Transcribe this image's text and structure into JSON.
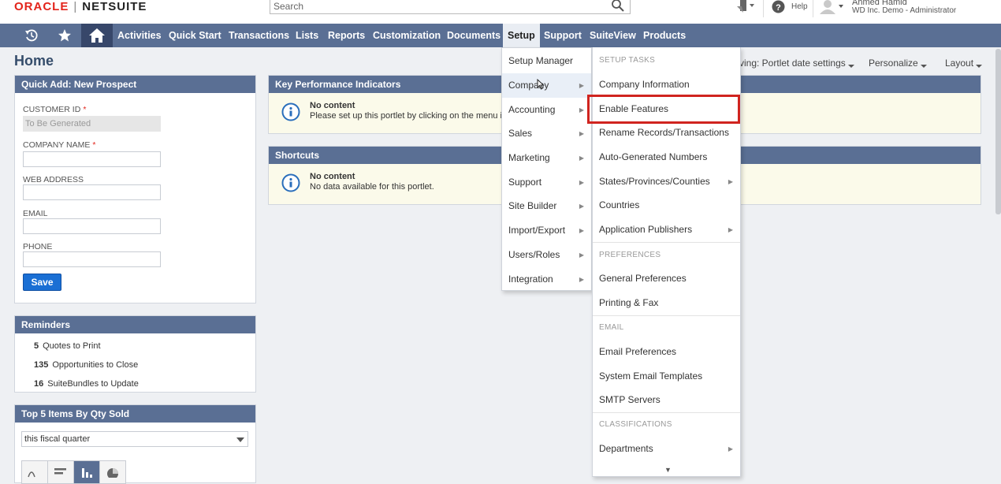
{
  "brand": {
    "oracle": "ORACLE",
    "netsuite": "NETSUITE"
  },
  "search": {
    "placeholder": "Search"
  },
  "header": {
    "help": "Help",
    "user_name": "Ahmed Hamid",
    "user_role": "WD Inc. Demo - Administrator"
  },
  "nav": {
    "items": [
      "Activities",
      "Quick Start",
      "Transactions",
      "Lists",
      "Reports",
      "Customization",
      "Documents",
      "Setup",
      "Support",
      "SuiteView",
      "Products"
    ],
    "active": "Setup"
  },
  "page": {
    "title": "Home",
    "viewing": "ving: Portlet date settings",
    "personalize": "Personalize",
    "layout": "Layout"
  },
  "quick_add": {
    "title": "Quick Add: New Prospect",
    "customer_id_label": "CUSTOMER ID",
    "customer_id_value": "To Be Generated",
    "company_name_label": "COMPANY NAME",
    "web_address_label": "WEB ADDRESS",
    "email_label": "EMAIL",
    "phone_label": "PHONE",
    "required_mark": "*",
    "save": "Save"
  },
  "reminders": {
    "title": "Reminders",
    "items": [
      {
        "count": "5",
        "label": "Quotes to Print"
      },
      {
        "count": "135",
        "label": "Opportunities to Close"
      },
      {
        "count": "16",
        "label": "SuiteBundles to Update"
      }
    ]
  },
  "top5": {
    "title": "Top 5 Items By Qty Sold",
    "period": "this fiscal quarter"
  },
  "kpi": {
    "title": "Key Performance Indicators",
    "no_content": "No content",
    "message": "Please set up this portlet by clicking on the menu ic"
  },
  "shortcuts": {
    "title": "Shortcuts",
    "no_content": "No content",
    "message": "No data available for this portlet."
  },
  "setup_menu": {
    "items": [
      "Setup Manager",
      "Company",
      "Accounting",
      "Sales",
      "Marketing",
      "Support",
      "Site Builder",
      "Import/Export",
      "Users/Roles",
      "Integration"
    ],
    "highlighted": "Company"
  },
  "company_menu": {
    "section_setup_tasks": "SETUP TASKS",
    "company_information": "Company Information",
    "enable_features": "Enable Features",
    "rename_records": "Rename Records/Transactions",
    "auto_numbers": "Auto-Generated Numbers",
    "states": "States/Provinces/Counties",
    "countries": "Countries",
    "app_publishers": "Application Publishers",
    "section_preferences": "PREFERENCES",
    "general_preferences": "General Preferences",
    "printing_fax": "Printing & Fax",
    "section_email": "EMAIL",
    "email_preferences": "Email Preferences",
    "system_email_templates": "System Email Templates",
    "smtp_servers": "SMTP Servers",
    "section_classifications": "CLASSIFICATIONS",
    "departments": "Departments"
  },
  "colors": {
    "nav_bg": "#5a6f94",
    "highlight_box": "#d0241f",
    "save_button": "#1a6fd4",
    "no_content_bg": "#fbfaea"
  }
}
